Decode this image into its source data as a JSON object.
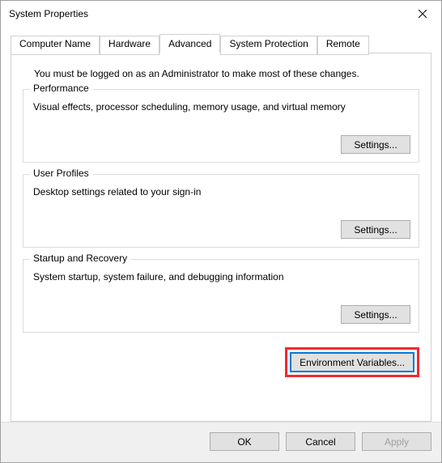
{
  "window": {
    "title": "System Properties"
  },
  "tabs": {
    "computer_name": "Computer Name",
    "hardware": "Hardware",
    "advanced": "Advanced",
    "system_protection": "System Protection",
    "remote": "Remote"
  },
  "intro_text": "You must be logged on as an Administrator to make most of these changes.",
  "performance": {
    "title": "Performance",
    "desc": "Visual effects, processor scheduling, memory usage, and virtual memory",
    "settings_label": "Settings..."
  },
  "user_profiles": {
    "title": "User Profiles",
    "desc": "Desktop settings related to your sign-in",
    "settings_label": "Settings..."
  },
  "startup_recovery": {
    "title": "Startup and Recovery",
    "desc": "System startup, system failure, and debugging information",
    "settings_label": "Settings..."
  },
  "env_vars": {
    "label": "Environment Variables..."
  },
  "buttons": {
    "ok": "OK",
    "cancel": "Cancel",
    "apply": "Apply"
  }
}
